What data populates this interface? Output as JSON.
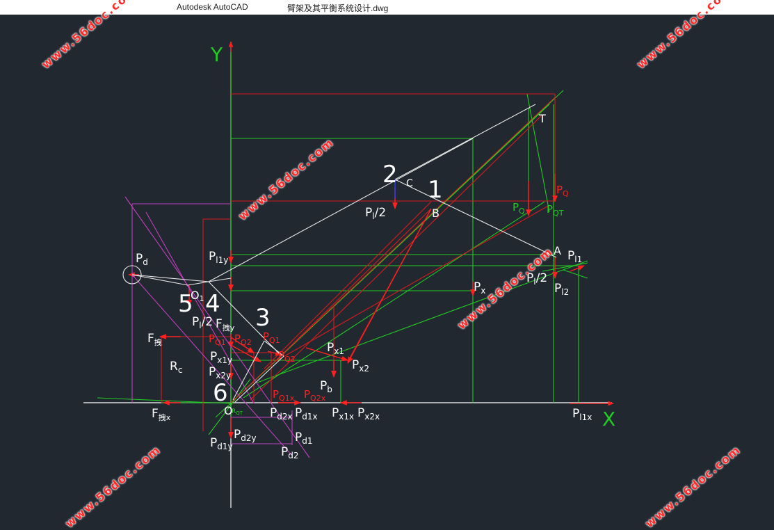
{
  "window": {
    "app_title": "Autodesk AutoCAD",
    "file_name": "臂架及其平衡系统设计.dwg"
  },
  "watermark": "www.56doc.com",
  "axes": {
    "x": "X",
    "y": "Y"
  },
  "points": {
    "p1": "1",
    "p2": "2",
    "p3": "3",
    "p4": "4",
    "p5": "5",
    "p6": "6",
    "A": "A",
    "B": "B",
    "C": "C",
    "O": "O",
    "T": "T",
    "O1": "O",
    "O1_sub": "1"
  },
  "labels": {
    "Pl_half_top": "P",
    "Pl_half_top_sub": "l",
    "Pl_half_top_tail": "/2",
    "PQ": "P",
    "PQ_sub": "Q",
    "PQ2": "P",
    "PQ2_sub": "Q",
    "PQT": "P",
    "PQT_sub": "QT",
    "Pl1": "P",
    "Pl1_sub": "l1",
    "Pl_half_A": "P",
    "Pl_half_A_sub": "l",
    "Pl_half_A_tail": "/2",
    "Pl2": "P",
    "Pl2_sub": "l2",
    "Px": "P",
    "Px_sub": "x",
    "Pd": "P",
    "Pd_sub": "d",
    "Pl1y": "P",
    "Pl1y_sub": "l1y",
    "Pl_half_4": "P",
    "Pl_half_4_sub": "l",
    "Pl_half_4_tail": "/2",
    "Fdiy": "F",
    "Fdiy_sub": "拽y",
    "Fdi": "F",
    "Fdi_sub": "拽",
    "Rc": "R",
    "Rc_sub": "c",
    "PQ1": "P",
    "PQ1_sub": "Q1",
    "PQ2y": "P",
    "PQ2y_sub": "Q2",
    "PQ1b": "P",
    "PQ1b_sub": "Q1",
    "PQ2b": "P",
    "PQ2b_sub": "Q2",
    "Px1y": "P",
    "Px1y_sub": "x1y",
    "Px2y": "P",
    "Px2y_sub": "x2y",
    "Px1": "P",
    "Px1_sub": "x1",
    "Px2": "P",
    "Px2_sub": "x2",
    "Pb": "P",
    "Pb_sub": "b",
    "PQ1x": "P",
    "PQ1x_sub": "Q1x",
    "PQ2x": "P",
    "PQ2x_sub": "Q2x",
    "Fdix": "F",
    "Fdix_sub": "拽x",
    "Pd2x": "P",
    "Pd2x_sub": "d2x",
    "Pd1x": "P",
    "Pd1x_sub": "d1x",
    "Px1x": "P",
    "Px1x_sub": "x1x",
    "Px2x": "P",
    "Px2x_sub": "x2x",
    "Pl1x": "P",
    "Pl1x_sub": "l1x",
    "Pd2y": "P",
    "Pd2y_sub": "d2y",
    "Pd1": "P",
    "Pd1_sub": "d1",
    "Pd1y": "P",
    "Pd1y_sub": "d1y",
    "Pd2": "P",
    "Pd2_sub": "d2",
    "RQT": "R",
    "RQT_sub": "QT"
  },
  "colors": {
    "background": "#212830",
    "white": "#ffffff",
    "green": "#22cc22",
    "red": "#e02020",
    "magenta": "#c040c0",
    "blue": "#2a3cff"
  }
}
